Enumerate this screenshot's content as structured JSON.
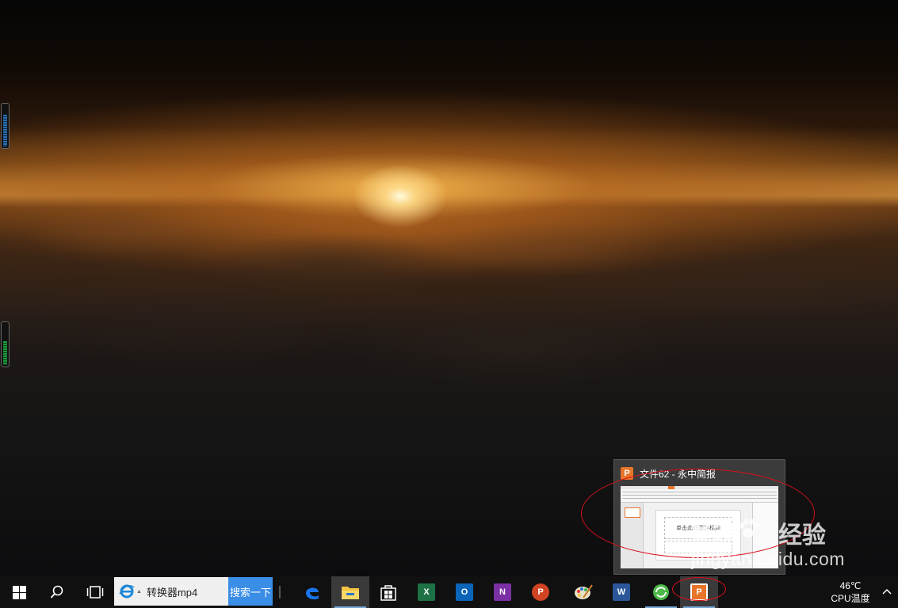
{
  "desktop": {
    "wallpaper": "sunrise-over-clouds"
  },
  "thumbnail": {
    "title": "文件62 - 永中简报",
    "app_icon": "yozo-presentation-icon",
    "preview_slide_title": "单击此处添加标题"
  },
  "watermark": {
    "logo": "Bai",
    "logo_cn": "经验",
    "url": "jingyan.baidu.com"
  },
  "taskbar": {
    "search_text": "转换器mp4",
    "search_button": "搜索一下",
    "apps": [
      {
        "name": "start",
        "icon": "windows-logo-icon"
      },
      {
        "name": "search",
        "icon": "search-icon"
      },
      {
        "name": "task-view",
        "icon": "task-view-icon"
      },
      {
        "name": "edge",
        "icon": "edge-icon"
      },
      {
        "name": "file-explorer",
        "icon": "folder-icon",
        "active": true
      },
      {
        "name": "store",
        "icon": "store-icon"
      },
      {
        "name": "excel",
        "icon": "excel-icon",
        "letter": "X"
      },
      {
        "name": "outlook",
        "icon": "outlook-icon",
        "letter": "O"
      },
      {
        "name": "onenote",
        "icon": "onenote-icon",
        "letter": "N"
      },
      {
        "name": "powerpoint",
        "icon": "powerpoint-icon",
        "letter": "P"
      },
      {
        "name": "paint",
        "icon": "paint-icon"
      },
      {
        "name": "word",
        "icon": "word-icon",
        "letter": "W"
      },
      {
        "name": "update",
        "icon": "refresh-icon"
      },
      {
        "name": "yozo",
        "icon": "yozo-presentation-icon",
        "letter": "P",
        "active": true
      }
    ],
    "tray": {
      "temp_value": "46℃",
      "temp_label": "CPU温度"
    }
  },
  "colors": {
    "taskbar": "#101010",
    "search_button": "#3a8ee6",
    "annotation": "#d8101a",
    "yozo_orange": "#e8742a"
  }
}
